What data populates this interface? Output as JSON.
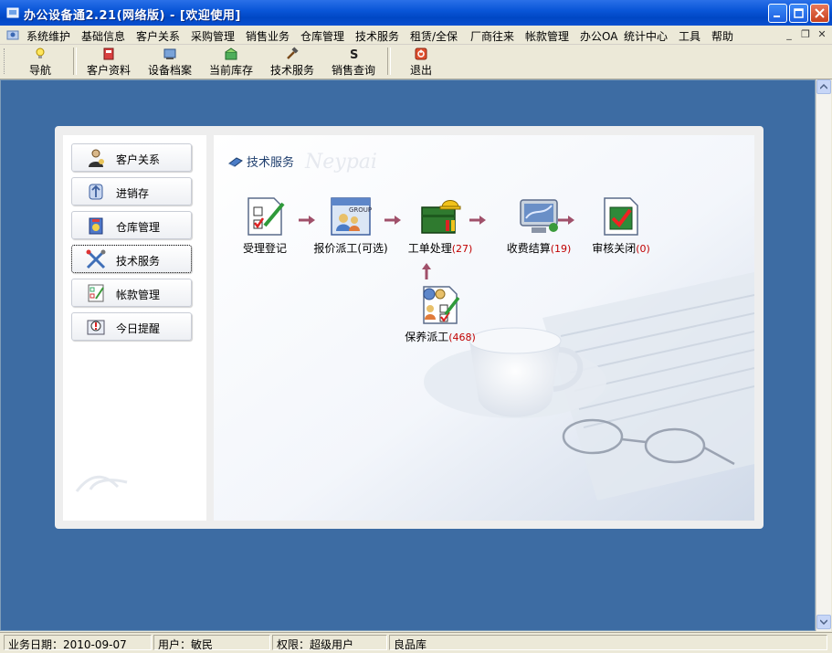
{
  "window": {
    "title": "办公设备通2.21(网络版) - [欢迎使用]"
  },
  "menubar": {
    "items": [
      "系统维护",
      "基础信息",
      "客户关系",
      "采购管理",
      "销售业务",
      "仓库管理",
      "技术服务",
      "租赁/全保",
      "厂商往来",
      "帐款管理",
      "办公OA",
      "统计中心",
      "工具",
      "帮助"
    ]
  },
  "toolbar": {
    "items": [
      {
        "label": "导航",
        "icon": "lightbulb-icon"
      },
      {
        "label": "客户资料",
        "icon": "customer-book-icon"
      },
      {
        "label": "设备档案",
        "icon": "device-file-icon"
      },
      {
        "label": "当前库存",
        "icon": "inventory-icon"
      },
      {
        "label": "技术服务",
        "icon": "hammer-icon"
      },
      {
        "label": "销售查询",
        "icon": "s-letter-icon"
      },
      {
        "label": "退出",
        "icon": "power-icon"
      }
    ]
  },
  "leftnav": {
    "items": [
      {
        "label": "客户关系",
        "icon": "handshake-icon"
      },
      {
        "label": "进销存",
        "icon": "trade-icon"
      },
      {
        "label": "仓库管理",
        "icon": "warehouse-icon"
      },
      {
        "label": "技术服务",
        "icon": "tools-icon",
        "active": true
      },
      {
        "label": "帐款管理",
        "icon": "checklist-icon"
      },
      {
        "label": "今日提醒",
        "icon": "alert-icon"
      }
    ]
  },
  "content": {
    "section_title": "技术服务",
    "watermark": "Neypai",
    "steps": {
      "accept": {
        "label": "受理登记",
        "count": ""
      },
      "quote": {
        "label": "报价派工(可选)",
        "count": ""
      },
      "workorder": {
        "label": "工单处理",
        "count": "(27)"
      },
      "settle": {
        "label": "收费结算",
        "count": "(19)"
      },
      "close": {
        "label": "审核关闭",
        "count": "(0)"
      },
      "maintenance": {
        "label": "保养派工",
        "count": "(468)"
      }
    }
  },
  "statusbar": {
    "date": "业务日期：2010-09-07",
    "user": "用户：敏民",
    "role": "权限：超级用户",
    "warehouse": "良品库"
  },
  "colors": {
    "titlebar": "#0a56d8",
    "workspace": "#3d6ca3",
    "count_red": "#c00000"
  }
}
